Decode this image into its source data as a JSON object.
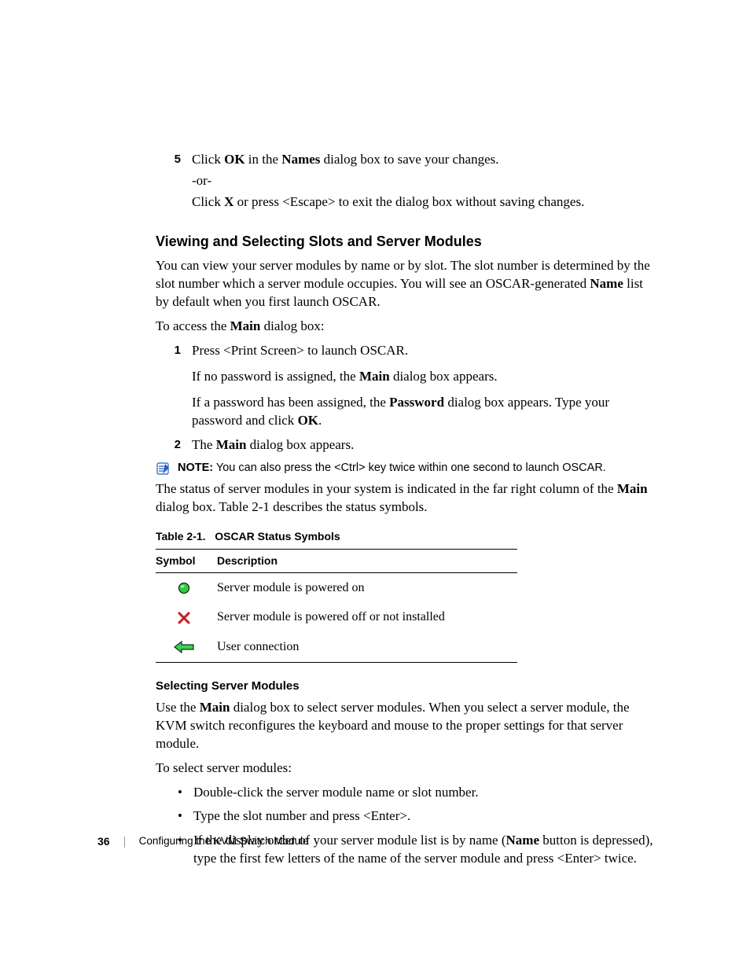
{
  "step5": {
    "num": "5",
    "line1a": "Click ",
    "line1b": "OK",
    "line1c": " in the ",
    "line1d": "Names",
    "line1e": " dialog box to save your changes.",
    "sub1": "-or-",
    "sub2a": "Click ",
    "sub2b": "X",
    "sub2c": " or press <Escape> to exit the dialog box without saving changes."
  },
  "section_heading": "Viewing and Selecting Slots and Server Modules",
  "para1a": "You can view your server modules by name or by slot. The slot number is determined by the slot number which a server module occupies. You will see an OSCAR-generated ",
  "para1b": "Name",
  "para1c": " list by default when you first launch OSCAR.",
  "para2a": "To access the ",
  "para2b": "Main",
  "para2c": " dialog box:",
  "step1": {
    "num": "1",
    "line": "Press <Print Screen> to launch OSCAR.",
    "sub1a": "If no password is assigned, the ",
    "sub1b": "Main",
    "sub1c": " dialog box appears.",
    "sub2a": "If a password has been assigned, the ",
    "sub2b": "Password",
    "sub2c": " dialog box appears. Type your password and click ",
    "sub2d": "OK",
    "sub2e": "."
  },
  "step2": {
    "num": "2",
    "a": "The ",
    "b": "Main",
    "c": " dialog box appears."
  },
  "note": {
    "label": "NOTE:",
    "text": " You can also press the <Ctrl> key twice within one second to launch OSCAR."
  },
  "para3a": "The status of server modules in your system is indicated in the far right column of the ",
  "para3b": "Main",
  "para3c": " dialog box. Table 2-1 describes the status symbols.",
  "table": {
    "caption_pre": "Table 2-1.",
    "caption_post": "OSCAR Status Symbols",
    "head_symbol": "Symbol",
    "head_desc": "Description",
    "rows": [
      {
        "desc": "Server module is powered on"
      },
      {
        "desc": "Server module is powered off or not installed"
      },
      {
        "desc": "User connection"
      }
    ]
  },
  "subsection_heading": "Selecting Server Modules",
  "para4a": "Use the ",
  "para4b": "Main",
  "para4c": " dialog box to select server modules. When you select a server module, the KVM switch reconfigures the keyboard and mouse to the proper settings for that server module.",
  "para5": "To select server modules:",
  "bullets": {
    "b1": "Double-click the server module name or slot number.",
    "b2": "Type the slot number and press <Enter>.",
    "b3a": "If the display order of your server module list is by name (",
    "b3b": "Name",
    "b3c": " button is depressed), type the first few letters of the name of the server module and press <Enter> twice."
  },
  "footer": {
    "page": "36",
    "chapter": "Configuring the KVM Switch Module"
  }
}
